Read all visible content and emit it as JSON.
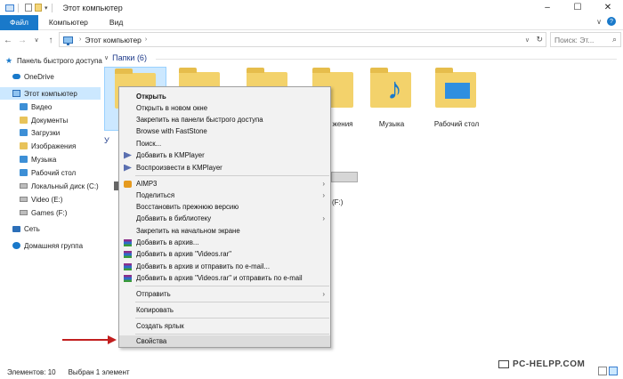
{
  "window": {
    "title": "Этот компьютер",
    "controls": {
      "minimize": "–",
      "maximize": "☐",
      "close": "✕"
    }
  },
  "ribbon": {
    "tabs": [
      {
        "label": "Файл",
        "active": true
      },
      {
        "label": "Компьютер"
      },
      {
        "label": "Вид"
      }
    ],
    "expand": "∨",
    "help": "?"
  },
  "address_bar": {
    "back": "←",
    "forward": "→",
    "recent": "∨",
    "up": "↑",
    "segments": [
      "Этот компьютер"
    ],
    "search_placeholder": "Поиск: Эт..."
  },
  "nav_pane": {
    "items": [
      {
        "label": "Панель быстрого доступа",
        "icon": "star-icon"
      },
      {
        "label": "OneDrive",
        "icon": "cloud-icon"
      },
      {
        "label": "Этот компьютер",
        "icon": "computer-icon",
        "selected": true
      },
      {
        "label": "Видео",
        "icon": "folder-icon"
      },
      {
        "label": "Документы",
        "icon": "folder-icon"
      },
      {
        "label": "Загрузки",
        "icon": "download-folder-icon"
      },
      {
        "label": "Изображения",
        "icon": "folder-icon"
      },
      {
        "label": "Музыка",
        "icon": "music-folder-icon"
      },
      {
        "label": "Рабочий стол",
        "icon": "desktop-folder-icon"
      },
      {
        "label": "Локальный диск (C:)",
        "icon": "drive-icon"
      },
      {
        "label": "Video (E:)",
        "icon": "drive-icon"
      },
      {
        "label": "Games (F:)",
        "icon": "drive-icon"
      },
      {
        "label": "Сеть",
        "icon": "network-icon"
      },
      {
        "label": "Домашняя группа",
        "icon": "homegroup-icon"
      }
    ]
  },
  "main": {
    "folders_header": "Папки (6)",
    "devices_header_fragment": "У",
    "folders": [
      {
        "label": ""
      },
      {
        "label": ""
      },
      {
        "label": ""
      },
      {
        "label": "жения"
      },
      {
        "label": "Музыка"
      },
      {
        "label": "Рабочий стол"
      }
    ],
    "drive_fragment": "(F:)"
  },
  "context_menu": {
    "items": [
      {
        "label": "Открыть",
        "bold": true
      },
      {
        "label": "Открыть в новом окне"
      },
      {
        "label": "Закрепить на панели быстрого доступа"
      },
      {
        "label": "Browse with FastStone"
      },
      {
        "label": "Поиск..."
      },
      {
        "label": "Добавить в KMPlayer",
        "icon": "kmplayer-icon"
      },
      {
        "label": "Воспроизвести в KMPlayer",
        "icon": "kmplayer-icon"
      },
      {
        "separator": true
      },
      {
        "label": "AIMP3",
        "icon": "aimp-icon",
        "submenu": true
      },
      {
        "label": "Поделиться",
        "submenu": true
      },
      {
        "label": "Восстановить прежнюю версию"
      },
      {
        "label": "Добавить в библиотеку",
        "submenu": true
      },
      {
        "label": "Закрепить на начальном экране"
      },
      {
        "label": "Добавить в архив...",
        "icon": "winrar-icon"
      },
      {
        "label": "Добавить в архив \"Videos.rar\"",
        "icon": "winrar-icon"
      },
      {
        "label": "Добавить в архив и отправить по e-mail...",
        "icon": "winrar-icon"
      },
      {
        "label": "Добавить в архив \"Videos.rar\" и отправить по e-mail",
        "icon": "winrar-icon"
      },
      {
        "separator": true
      },
      {
        "label": "Отправить",
        "submenu": true
      },
      {
        "separator": true
      },
      {
        "label": "Копировать"
      },
      {
        "separator": true
      },
      {
        "label": "Создать ярлык"
      },
      {
        "separator": true
      },
      {
        "label": "Свойства",
        "highlighted": true
      }
    ],
    "submenu_glyph": "›"
  },
  "status_bar": {
    "items_count": "Элементов: 10",
    "selected": "Выбран 1 элемент"
  },
  "watermark": "PC-HELPP.COM",
  "colors": {
    "accent": "#1979ca",
    "selection": "#cce8ff",
    "arrow": "#c21f1f"
  }
}
